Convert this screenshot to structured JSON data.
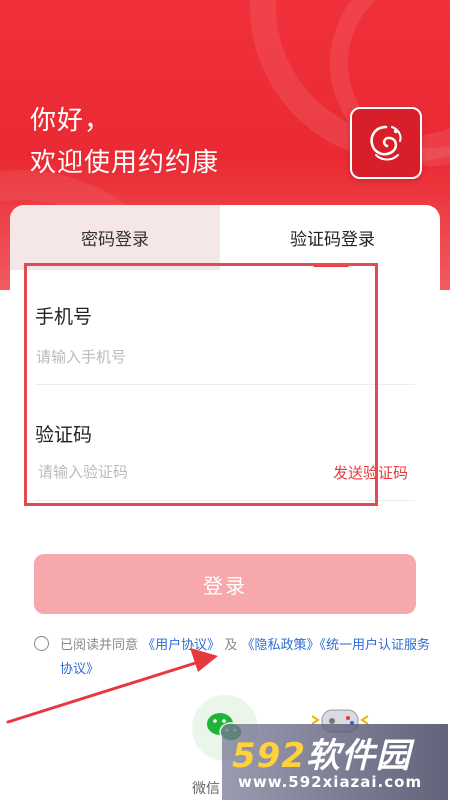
{
  "header": {
    "greeting_line1": "你好，",
    "greeting_line2": "欢迎使用约约康"
  },
  "tabs": [
    {
      "label": "密码登录",
      "active": false
    },
    {
      "label": "验证码登录",
      "active": true
    }
  ],
  "form": {
    "phone_label": "手机号",
    "phone_placeholder": "请输入手机号",
    "code_label": "验证码",
    "code_placeholder": "请输入验证码",
    "send_code": "发送验证码"
  },
  "login_button": "登录",
  "agreement": {
    "prefix": "已阅读并同意",
    "user_agreement": "《用户协议》",
    "and": "及",
    "privacy": "《隐私政策》",
    "unified_auth": "《统一用户认证服务协议》"
  },
  "third_party": {
    "wechat_label": "微信"
  },
  "watermark": {
    "number": "592",
    "name": "软件园",
    "url": "www.592xiazai.com"
  },
  "colors": {
    "brand_red": "#ea2a33",
    "link_blue": "#2d6bd3",
    "button_disabled": "#f7a8ac"
  },
  "icons": {
    "logo": "app-logo-icon",
    "wechat": "wechat-icon",
    "game": "gamepad-icon"
  }
}
